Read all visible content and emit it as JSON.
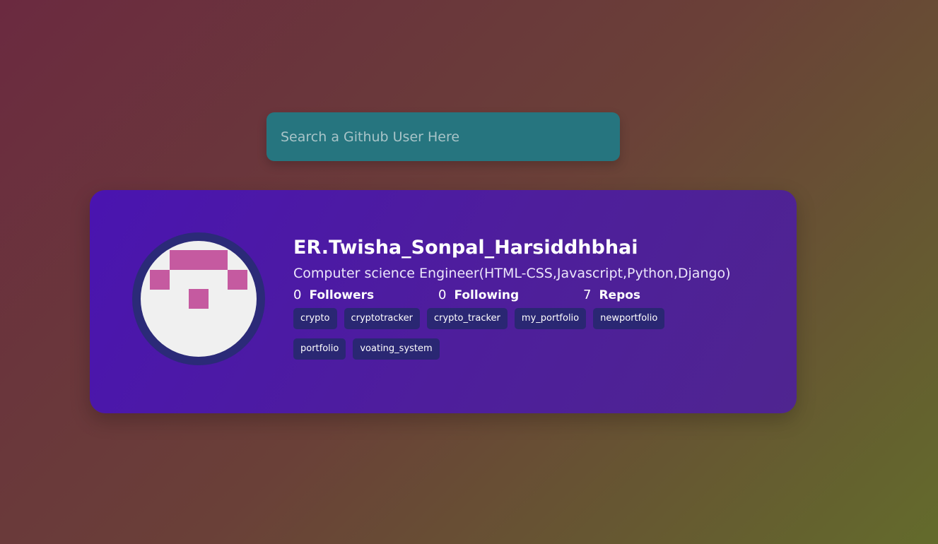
{
  "search": {
    "placeholder": "Search a Github User Here",
    "value": ""
  },
  "profile": {
    "name": "ER.Twisha_Sonpal_Harsiddhbhai",
    "bio": "Computer science Engineer(HTML-CSS,Javascript,Python,Django)",
    "avatar_icon": "identicon-avatar",
    "stats": {
      "followers": {
        "count": "0",
        "label": "Followers"
      },
      "following": {
        "count": "0",
        "label": "Following"
      },
      "repos": {
        "count": "7",
        "label": "Repos"
      }
    },
    "repos": [
      "crypto",
      "cryptotracker",
      "crypto_tracker",
      "my_portfolio",
      "newportfolio",
      "portfolio",
      "voating_system"
    ]
  },
  "colors": {
    "search_bg": "#26757f",
    "card_bg": "#4a14b0",
    "repo_bg": "#2a2773",
    "avatar_border": "#2b2a78",
    "identicon": "#c55aa0"
  }
}
